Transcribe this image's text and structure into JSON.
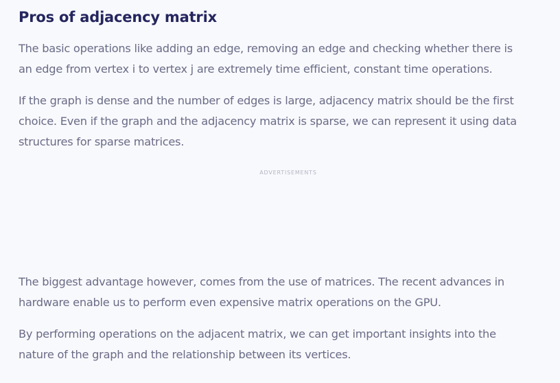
{
  "article": {
    "heading": "Pros of adjacency matrix",
    "paragraphs": [
      {
        "lines": [
          "The basic operations like adding an edge, removing an edge and checking whether there is",
          "an edge from vertex i to vertex j are extremely time efficient, constant time operations."
        ]
      },
      {
        "lines": [
          "If the graph is dense and the number of edges is large, adjacency matrix should be the first",
          "choice. Even if the graph and the adjacency matrix is sparse, we can represent it using data",
          "structures for sparse matrices."
        ]
      },
      {
        "lines": [
          "The biggest advantage however, comes from the use of matrices. The recent advances in",
          "hardware enable us to perform even expensive matrix operations on the GPU."
        ]
      },
      {
        "lines": [
          "By performing operations on the adjacent matrix, we can get important insights into the",
          "nature of the graph and the relationship between its vertices."
        ]
      }
    ],
    "ad_label": "ADVERTISEMENTS"
  },
  "colors": {
    "background": "#f8f9fc",
    "heading": "#25265e",
    "body_text": "#6a6b87",
    "ad_label": "#b3b5c6"
  }
}
